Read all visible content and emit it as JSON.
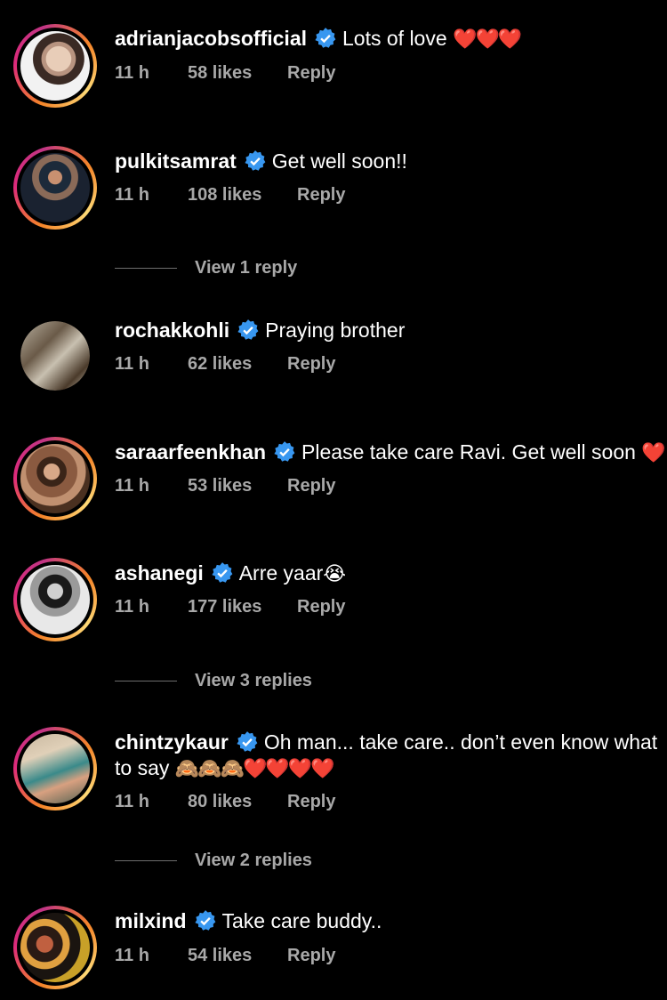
{
  "comments": [
    {
      "username": "adrianjacobsofficial",
      "text": "Lots of love ",
      "emoji": "❤️❤️❤️",
      "time": "11 h",
      "likes": "58 likes",
      "reply": "Reply",
      "avatar_icon": "profile-photo"
    },
    {
      "username": "pulkitsamrat",
      "text": "Get well soon!!",
      "emoji": "",
      "time": "11 h",
      "likes": "108 likes",
      "reply": "Reply",
      "avatar_icon": "profile-photo"
    },
    {
      "username": "rochakkohli",
      "text": "Praying brother",
      "emoji": "",
      "time": "11 h",
      "likes": "62 likes",
      "reply": "Reply",
      "avatar_icon": "profile-photo"
    },
    {
      "username": "saraarfeenkhan",
      "text": "Please take care Ravi. Get well soon ",
      "emoji": "❤️",
      "time": "11 h",
      "likes": "53 likes",
      "reply": "Reply",
      "avatar_icon": "profile-photo"
    },
    {
      "username": "ashanegi",
      "text": "Arre yaar",
      "emoji": "😭",
      "time": "11 h",
      "likes": "177 likes",
      "reply": "Reply",
      "avatar_icon": "profile-photo"
    },
    {
      "username": "chintzykaur",
      "text": "Oh man... take care.. don’t even know what to say ",
      "emoji": "🙈🙈🙈❤️❤️❤️❤️",
      "time": "11 h",
      "likes": "80 likes",
      "reply": "Reply",
      "avatar_icon": "profile-photo"
    },
    {
      "username": "milxind",
      "text": "Take care buddy..",
      "emoji": "",
      "time": "11 h",
      "likes": "54 likes",
      "reply": "Reply",
      "avatar_icon": "profile-photo"
    }
  ],
  "view_replies": [
    "View 1 reply",
    "View 3 replies",
    "View 2 replies"
  ],
  "colors": {
    "background": "#000000",
    "verified": "#3897f0",
    "muted": "#a8a8a8",
    "heart": "#ff2d3c"
  }
}
